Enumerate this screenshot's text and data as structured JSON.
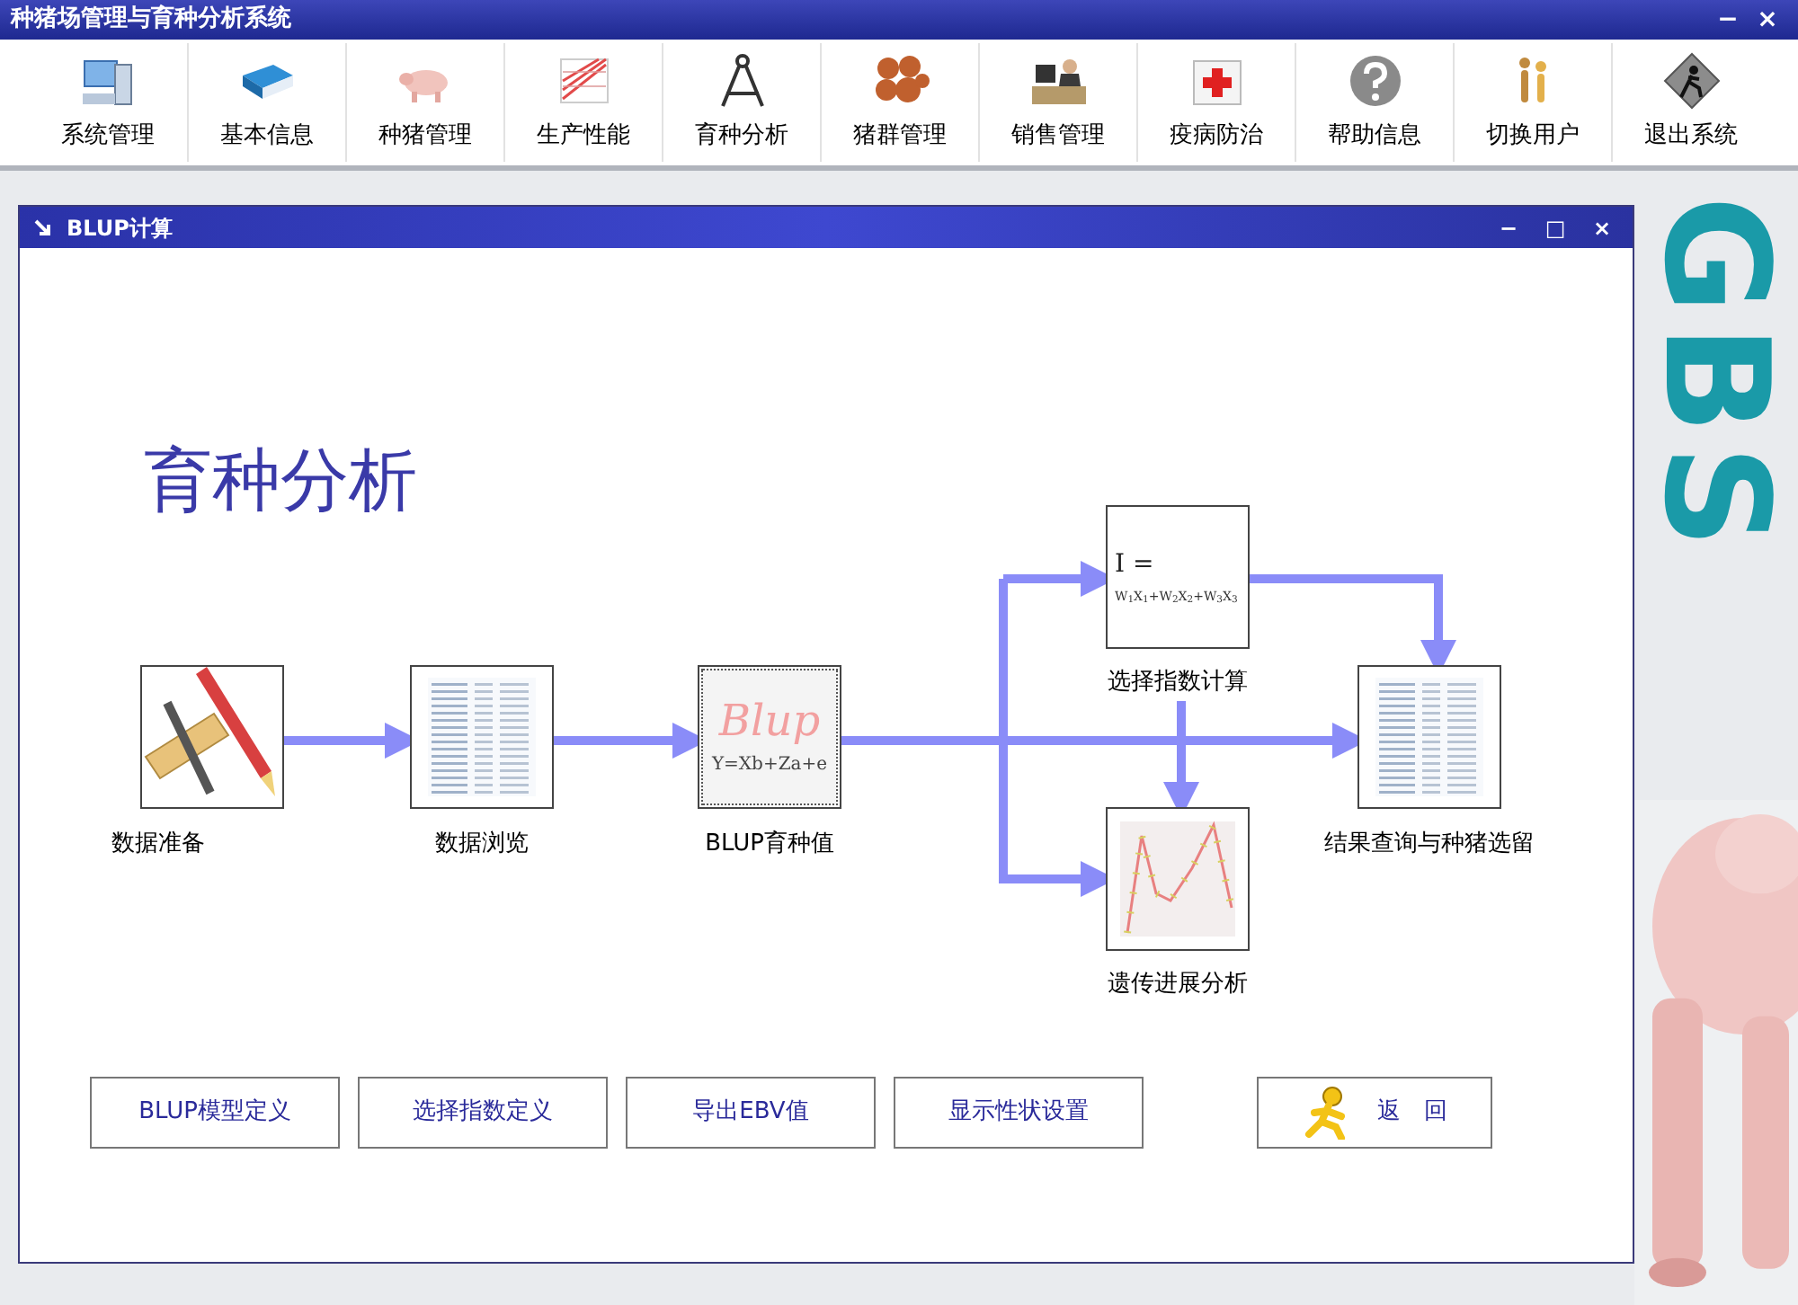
{
  "app_window": {
    "title": "种猪场管理与育种分析系统",
    "controls": [
      "−",
      "×"
    ]
  },
  "toolbar": [
    {
      "label": "系统管理",
      "kind": "computer"
    },
    {
      "label": "基本信息",
      "kind": "book"
    },
    {
      "label": "种猪管理",
      "kind": "pig"
    },
    {
      "label": "生产性能",
      "kind": "graph"
    },
    {
      "label": "育种分析",
      "kind": "compass"
    },
    {
      "label": "猪群管理",
      "kind": "herd"
    },
    {
      "label": "销售管理",
      "kind": "desk"
    },
    {
      "label": "疫病防治",
      "kind": "medical"
    },
    {
      "label": "帮助信息",
      "kind": "help"
    },
    {
      "label": "切换用户",
      "kind": "users"
    },
    {
      "label": "退出系统",
      "kind": "exit"
    }
  ],
  "backdrop": {
    "logo": "GBS"
  },
  "dialog": {
    "title": "BLUP计算",
    "controls": [
      "−",
      "□",
      "×"
    ],
    "heading": "育种分析",
    "nodes": [
      {
        "label": "数据准备",
        "kind": "tools"
      },
      {
        "label": "数据浏览",
        "kind": "table"
      },
      {
        "label": "BLUP育种值",
        "kind": "blup",
        "logo_text": "Blup",
        "formula": "Y=Xb+Za+e"
      },
      {
        "label": "选择指数计算",
        "kind": "formula",
        "formula_lines": [
          "I =",
          "W$_{1}$X$_{1}$+W$_{2}$X$_{2}$+W$_{3}$X$_{3}$"
        ]
      },
      {
        "label": "遗传进展分析",
        "kind": "chart"
      },
      {
        "label": "结果查询与种猪选留",
        "kind": "table"
      }
    ],
    "buttons": [
      {
        "label": "BLUP模型定义",
        "kind": "plain"
      },
      {
        "label": "选择指数定义",
        "kind": "plain"
      },
      {
        "label": "导出EBV值",
        "kind": "plain"
      },
      {
        "label": "显示性状设置",
        "kind": "plain"
      },
      {
        "label": "返　回",
        "kind": "return"
      }
    ]
  }
}
